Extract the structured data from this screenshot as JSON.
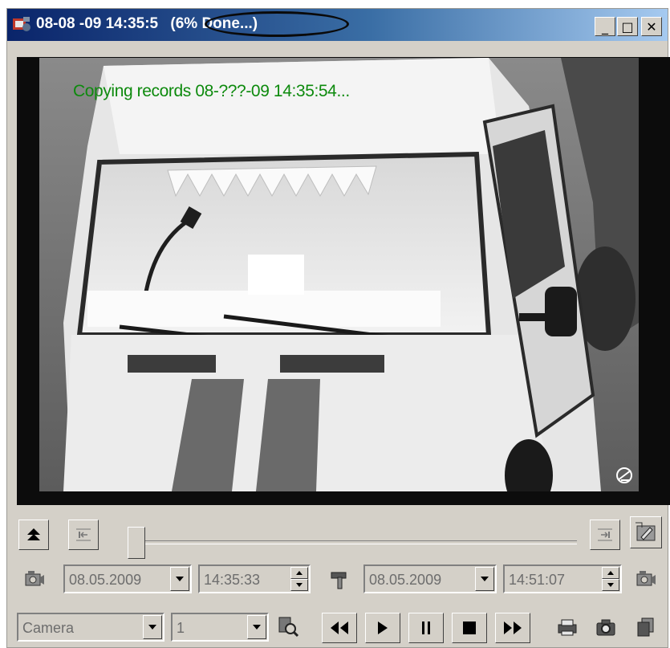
{
  "window": {
    "title_prefix": "08-08 -09 14:35:5",
    "title_progress": "(6% Done...)",
    "minimize_glyph": "_",
    "maximize_glyph": "□",
    "close_glyph": "✕"
  },
  "video": {
    "overlay_text": "Copying records 08-???-09 14:35:54...",
    "overlay_color": "#0d8a0d"
  },
  "timeline": {
    "position_fraction": 0.0
  },
  "range": {
    "start_date": "08.05.2009",
    "start_time": "14:35:33",
    "end_date": "08.05.2009",
    "end_time": "14:51:07"
  },
  "controls": {
    "camera_value": "Camera",
    "number_value": "1"
  },
  "colors": {
    "title_start": "#0a246a",
    "title_end": "#a6caf0",
    "face": "#d4d0c8"
  }
}
